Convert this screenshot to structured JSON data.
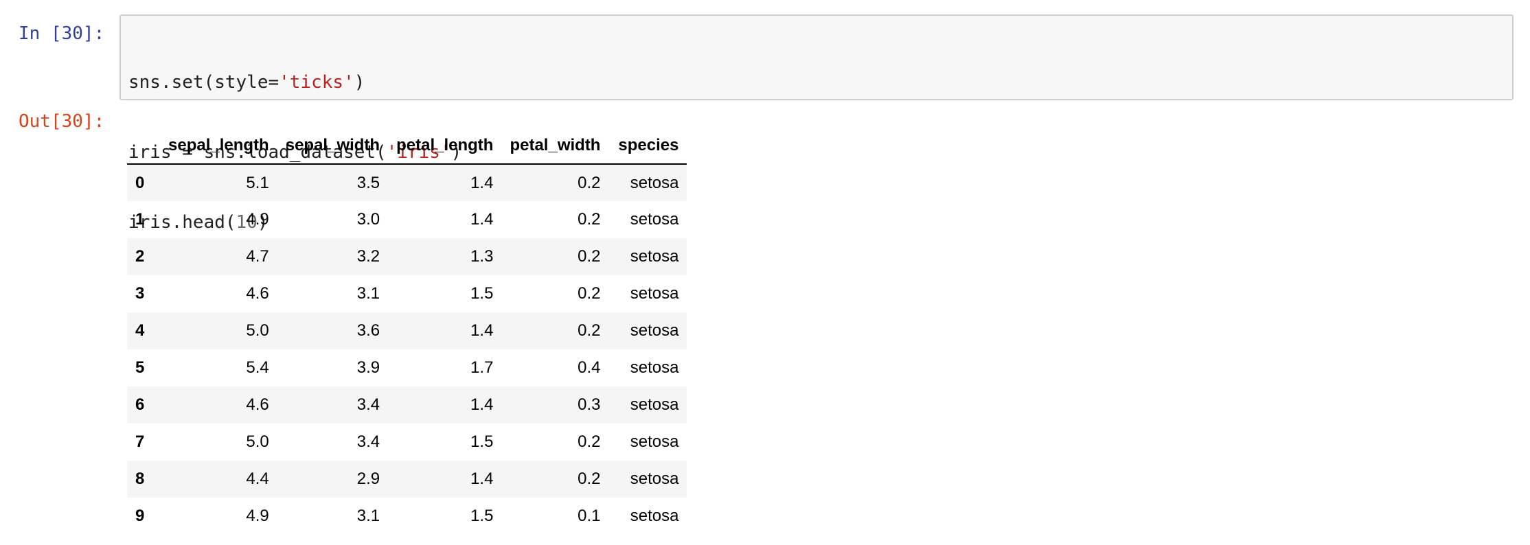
{
  "cell": {
    "in_prompt": "In [30]:",
    "out_prompt": "Out[30]:",
    "code": {
      "line1_pre": "sns.set(style=",
      "line1_str": "'ticks'",
      "line1_post": ")",
      "line2_pre": "iris = sns.load_dataset(",
      "line2_str": "'iris'",
      "line2_post": ")",
      "line3_pre": "iris.head(",
      "line3_num": "10",
      "line3_post": ")"
    }
  },
  "table": {
    "columns": [
      "sepal_length",
      "sepal_width",
      "petal_length",
      "petal_width",
      "species"
    ],
    "rows": [
      {
        "index": "0",
        "cells": [
          "5.1",
          "3.5",
          "1.4",
          "0.2",
          "setosa"
        ]
      },
      {
        "index": "1",
        "cells": [
          "4.9",
          "3.0",
          "1.4",
          "0.2",
          "setosa"
        ]
      },
      {
        "index": "2",
        "cells": [
          "4.7",
          "3.2",
          "1.3",
          "0.2",
          "setosa"
        ]
      },
      {
        "index": "3",
        "cells": [
          "4.6",
          "3.1",
          "1.5",
          "0.2",
          "setosa"
        ]
      },
      {
        "index": "4",
        "cells": [
          "5.0",
          "3.6",
          "1.4",
          "0.2",
          "setosa"
        ]
      },
      {
        "index": "5",
        "cells": [
          "5.4",
          "3.9",
          "1.7",
          "0.4",
          "setosa"
        ]
      },
      {
        "index": "6",
        "cells": [
          "4.6",
          "3.4",
          "1.4",
          "0.3",
          "setosa"
        ]
      },
      {
        "index": "7",
        "cells": [
          "5.0",
          "3.4",
          "1.5",
          "0.2",
          "setosa"
        ]
      },
      {
        "index": "8",
        "cells": [
          "4.4",
          "2.9",
          "1.4",
          "0.2",
          "setosa"
        ]
      },
      {
        "index": "9",
        "cells": [
          "4.9",
          "3.1",
          "1.5",
          "0.1",
          "setosa"
        ]
      }
    ]
  }
}
